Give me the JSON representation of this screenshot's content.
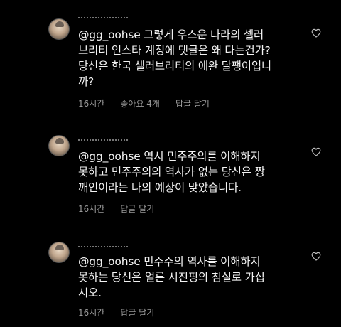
{
  "comments": [
    {
      "mention": "@gg_oohse",
      "lines": [
        " 그렇게 우스운 나라의 셀러",
        "브리티 인스타 계정에 댓글은 왜 다는건가?",
        "당신은 한국 셀러브리티의 애완 달팽이입니",
        "까?"
      ],
      "time": "16시간",
      "likes": "좋아요 4개",
      "reply": "답글 달기"
    },
    {
      "mention": "@gg_oohse",
      "lines": [
        " 역시 민주주의를 이해하지",
        "못하고 민주주의의 역사가 없는 당신은 짱",
        "깨인이라는 나의 예상이 맞았습니다."
      ],
      "time": "16시간",
      "reply": "답글 달기"
    },
    {
      "mention": "@gg_oohse",
      "lines": [
        " 민주주의 역사를 이해하지",
        "못하는 당신은 얼른 시진핑의 침실로 가십",
        "시오."
      ],
      "time": "16시간",
      "reply": "답글 달기"
    }
  ]
}
